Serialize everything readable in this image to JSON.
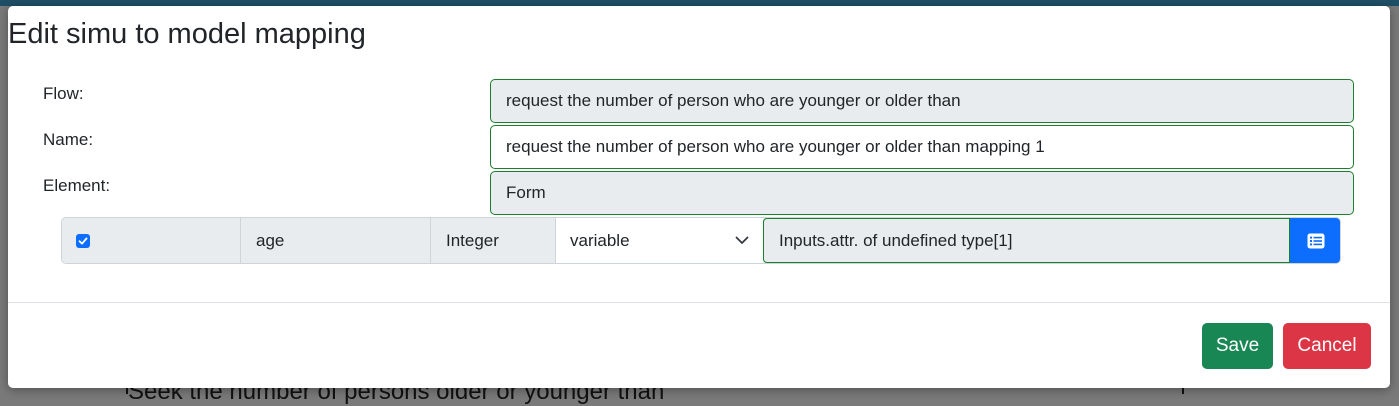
{
  "dialog": {
    "title": "Edit simu to model mapping",
    "labels": {
      "flow": "Flow:",
      "name": "Name:",
      "element": "Element:"
    },
    "fields": {
      "flow_value": "request the number of person who are younger or older than",
      "name_value": "request the number of person who are younger or older than mapping 1",
      "element_value": "Form"
    },
    "mapping_row": {
      "checked": true,
      "attribute_name": "age",
      "attribute_type": "Integer",
      "select_value": "variable",
      "input_value": "Inputs.attr. of undefined type[1]",
      "button_icon": "list-icon"
    },
    "buttons": {
      "save": "Save",
      "cancel": "Cancel"
    }
  },
  "background": {
    "heading_fragment": "Seek the number of persons older or younger than"
  },
  "colors": {
    "accent_blue": "#0d6efd",
    "valid_border": "#1a7f2e",
    "save_green": "#198754",
    "cancel_red": "#dc3545"
  }
}
